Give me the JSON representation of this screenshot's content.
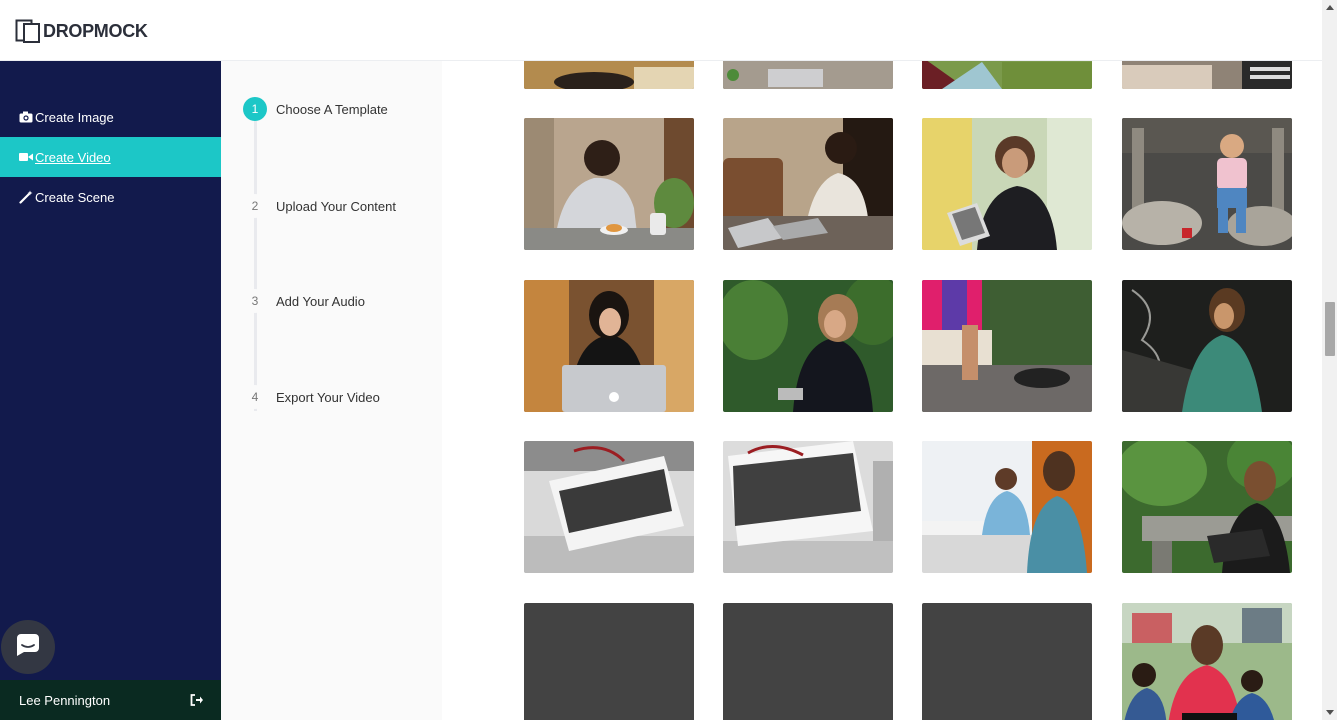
{
  "app": {
    "logo_text": "DROPMOCK"
  },
  "sidebar": {
    "items": [
      {
        "label": "Create Image",
        "icon": "camera-icon",
        "active": false
      },
      {
        "label": "Create Video",
        "icon": "video-camera-icon",
        "active": true
      },
      {
        "label": "Create Scene",
        "icon": "magic-wand-icon",
        "active": false
      }
    ],
    "user_name": "Lee Pennington"
  },
  "steps": [
    {
      "number": "1",
      "label": "Choose A Template",
      "active": true
    },
    {
      "number": "2",
      "label": "Upload Your Content",
      "active": false
    },
    {
      "number": "3",
      "label": "Add Your Audio",
      "active": false
    },
    {
      "number": "4",
      "label": "Export Your Video",
      "active": false
    }
  ],
  "templates": [
    {
      "desc": "cropped video thumbnail",
      "kind": "partial"
    },
    {
      "desc": "cropped video thumbnail",
      "kind": "partial"
    },
    {
      "desc": "cropped video thumbnail",
      "kind": "partial"
    },
    {
      "desc": "cropped video thumbnail",
      "kind": "partial"
    },
    {
      "desc": "man eating at table with laptop",
      "kind": "photo"
    },
    {
      "desc": "man using laptop on sofa",
      "kind": "photo"
    },
    {
      "desc": "woman using tablet",
      "kind": "photo"
    },
    {
      "desc": "child sitting on rocks",
      "kind": "photo"
    },
    {
      "desc": "woman with macbook",
      "kind": "photo"
    },
    {
      "desc": "woman with phone outdoors",
      "kind": "photo"
    },
    {
      "desc": "phone on stone bench",
      "kind": "photo"
    },
    {
      "desc": "woman on phone by chalkboard",
      "kind": "photo"
    },
    {
      "desc": "billboard in mall",
      "kind": "photo"
    },
    {
      "desc": "billboard in mall",
      "kind": "photo"
    },
    {
      "desc": "women at office desk",
      "kind": "photo"
    },
    {
      "desc": "woman with laptop in garden",
      "kind": "photo"
    },
    {
      "desc": "",
      "kind": "empty"
    },
    {
      "desc": "",
      "kind": "empty"
    },
    {
      "desc": "",
      "kind": "empty"
    },
    {
      "desc": "family outdoors with laptop",
      "kind": "photo"
    }
  ],
  "colors": {
    "accent": "#1cc7c7",
    "sidebar_bg": "#121a4c",
    "user_bar_bg": "#0a2a21"
  }
}
